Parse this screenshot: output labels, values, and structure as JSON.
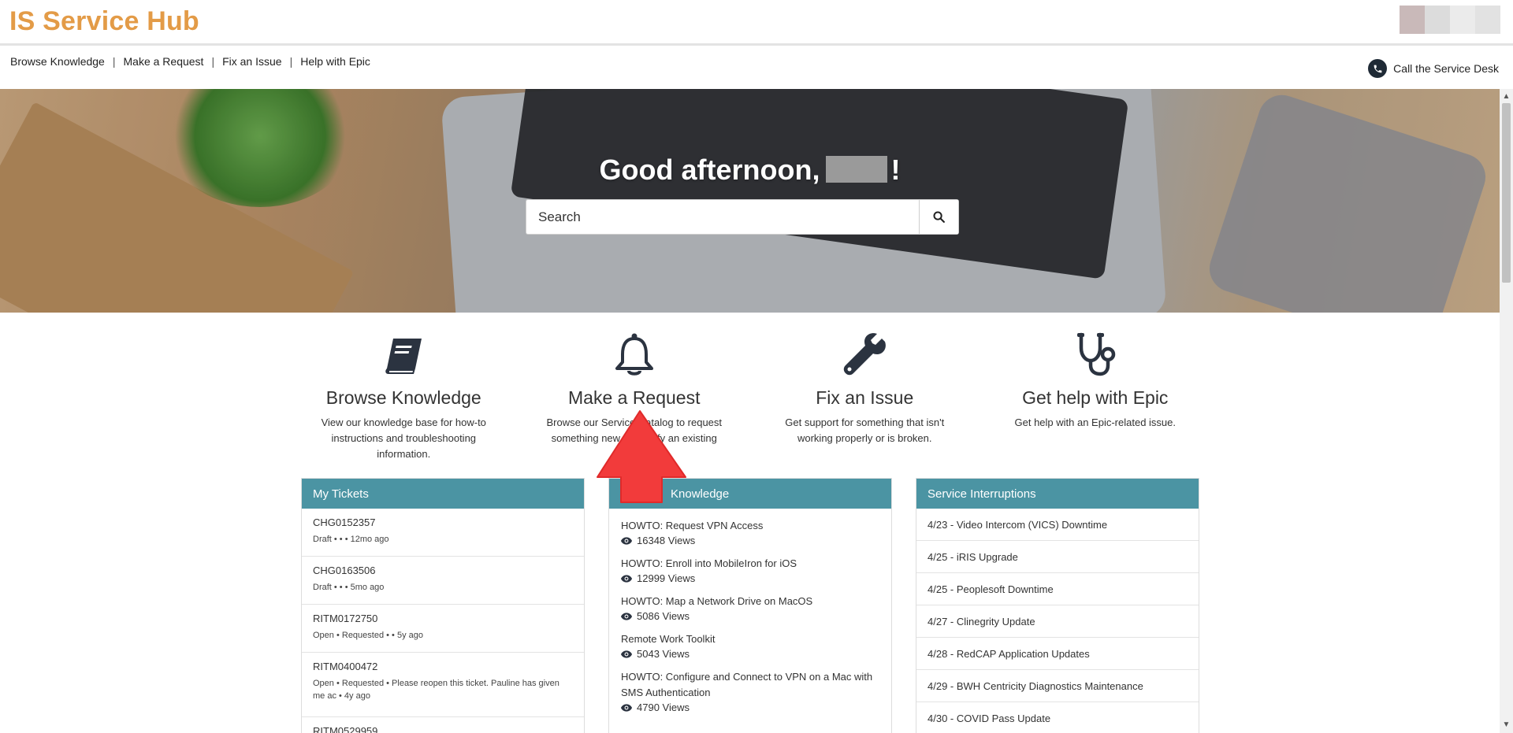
{
  "brand": "IS Service Hub",
  "nav": {
    "browse": "Browse Knowledge",
    "request": "Make a Request",
    "fix": "Fix an Issue",
    "epic": "Help with Epic",
    "separator": "|",
    "call": "Call the Service Desk"
  },
  "hero": {
    "greeting": "Good afternoon,",
    "greeting_end": "!",
    "search_placeholder": "Search"
  },
  "categories": [
    {
      "icon": "book-icon",
      "title": "Browse Knowledge",
      "desc": "View our knowledge base for how-to instructions and troubleshooting information."
    },
    {
      "icon": "bell-icon",
      "title": "Make a Request",
      "desc": "Browse our Service Catalog to request something new or modify an existing"
    },
    {
      "icon": "wrench-icon",
      "title": "Fix an Issue",
      "desc": "Get support for something that isn't working properly or is broken."
    },
    {
      "icon": "stethoscope-icon",
      "title": "Get help with Epic",
      "desc": "Get help with an Epic-related issue."
    }
  ],
  "tickets": {
    "title": "My Tickets",
    "items": [
      {
        "num": "CHG0152357",
        "meta": "Draft • • • 12mo ago"
      },
      {
        "num": "CHG0163506",
        "meta": "Draft • • • 5mo ago"
      },
      {
        "num": "RITM0172750",
        "meta": "Open • Requested • • 5y ago"
      },
      {
        "num": "RITM0400472",
        "meta": "Open • Requested • Please reopen this ticket. Pauline has given me ac • 4y ago"
      },
      {
        "num": "RITM0529959",
        "meta": ""
      }
    ]
  },
  "knowledge": {
    "title": "Knowledge",
    "items": [
      {
        "title": "HOWTO: Request VPN Access",
        "views": "16348 Views"
      },
      {
        "title": "HOWTO: Enroll into MobileIron for iOS",
        "views": "12999 Views"
      },
      {
        "title": "HOWTO: Map a Network Drive on MacOS",
        "views": "5086 Views"
      },
      {
        "title": "Remote Work Toolkit",
        "views": "5043 Views"
      },
      {
        "title": "HOWTO: Configure and Connect to VPN on a Mac with SMS Authentication",
        "views": "4790 Views"
      }
    ]
  },
  "interruptions": {
    "title": "Service Interruptions",
    "items": [
      "4/23 - Video Intercom (VICS) Downtime",
      "4/25 - iRIS Upgrade",
      "4/25 - Peoplesoft Downtime",
      "4/27 - Clinegrity Update",
      "4/28 - RedCAP Application Updates",
      "4/29 - BWH Centricity Diagnostics Maintenance",
      "4/30 - COVID Pass Update"
    ]
  },
  "colors": {
    "brand": "#e39b47",
    "panel_header": "#4b94a3",
    "arrow": "#f23b3b"
  }
}
